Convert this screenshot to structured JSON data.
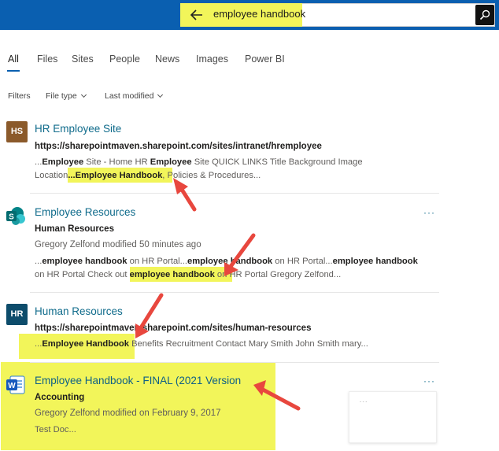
{
  "search": {
    "query": "employee handbook"
  },
  "tabs": [
    "All",
    "Files",
    "Sites",
    "People",
    "News",
    "Images",
    "Power BI"
  ],
  "filters": {
    "label": "Filters",
    "file_type": "File type",
    "last_modified": "Last modified"
  },
  "results": [
    {
      "icon": "HS",
      "title": "HR Employee Site",
      "url": "https://sharepointmaven.sharepoint.com/sites/intranet/hremployee",
      "snippet1_a": "...",
      "snippet1_b": "Employee",
      "snippet1_c": " Site - Home HR ",
      "snippet1_d": "Employee",
      "snippet1_e": " Site QUICK LINKS Title Background Image",
      "snippet2_a": "Location",
      "snippet2_b": "...Employee Handbook",
      "snippet2_c": ", Policies & Procedures..."
    },
    {
      "icon": "S",
      "title": "Employee Resources",
      "subtitle": "Human Resources",
      "modified": "Gregory Zelfond modified 50 minutes ago",
      "snippet1_a": "...",
      "snippet1_b": "employee handbook",
      "snippet1_c": " on HR Portal...",
      "snippet1_d": "employee handbook",
      "snippet1_e": " on HR Portal...",
      "snippet1_f": "employee handbook",
      "snippet2_a": "on HR Portal Check out ",
      "snippet2_b": "employee handbook",
      "snippet2_c": " on HR Portal Gregory Zelfond...",
      "more": "···"
    },
    {
      "icon": "HR",
      "title": "Human Resources",
      "url": "https://sharepointmaven.sharepoint.com/sites/human-resources",
      "snippet_a": "...",
      "snippet_b": "Employee Handbook",
      "snippet_c": " Benefits Recruitment Contact Mary Smith John Smith mary..."
    },
    {
      "icon": "W",
      "title": "Employee Handbook - FINAL (2021 Version",
      "subtitle": "Accounting",
      "modified": "Gregory Zelfond modified on February 9, 2017",
      "snippet": "Test Doc...",
      "more": "···"
    }
  ],
  "colors": {
    "topbar": "#0a5fb0",
    "highlight": "#f2f55a",
    "link": "#0f6b8b",
    "arrow": "#e8473e"
  },
  "icons": [
    "back-arrow-icon",
    "search-icon",
    "chevron-down-icon",
    "sharepoint-icon",
    "word-icon"
  ]
}
